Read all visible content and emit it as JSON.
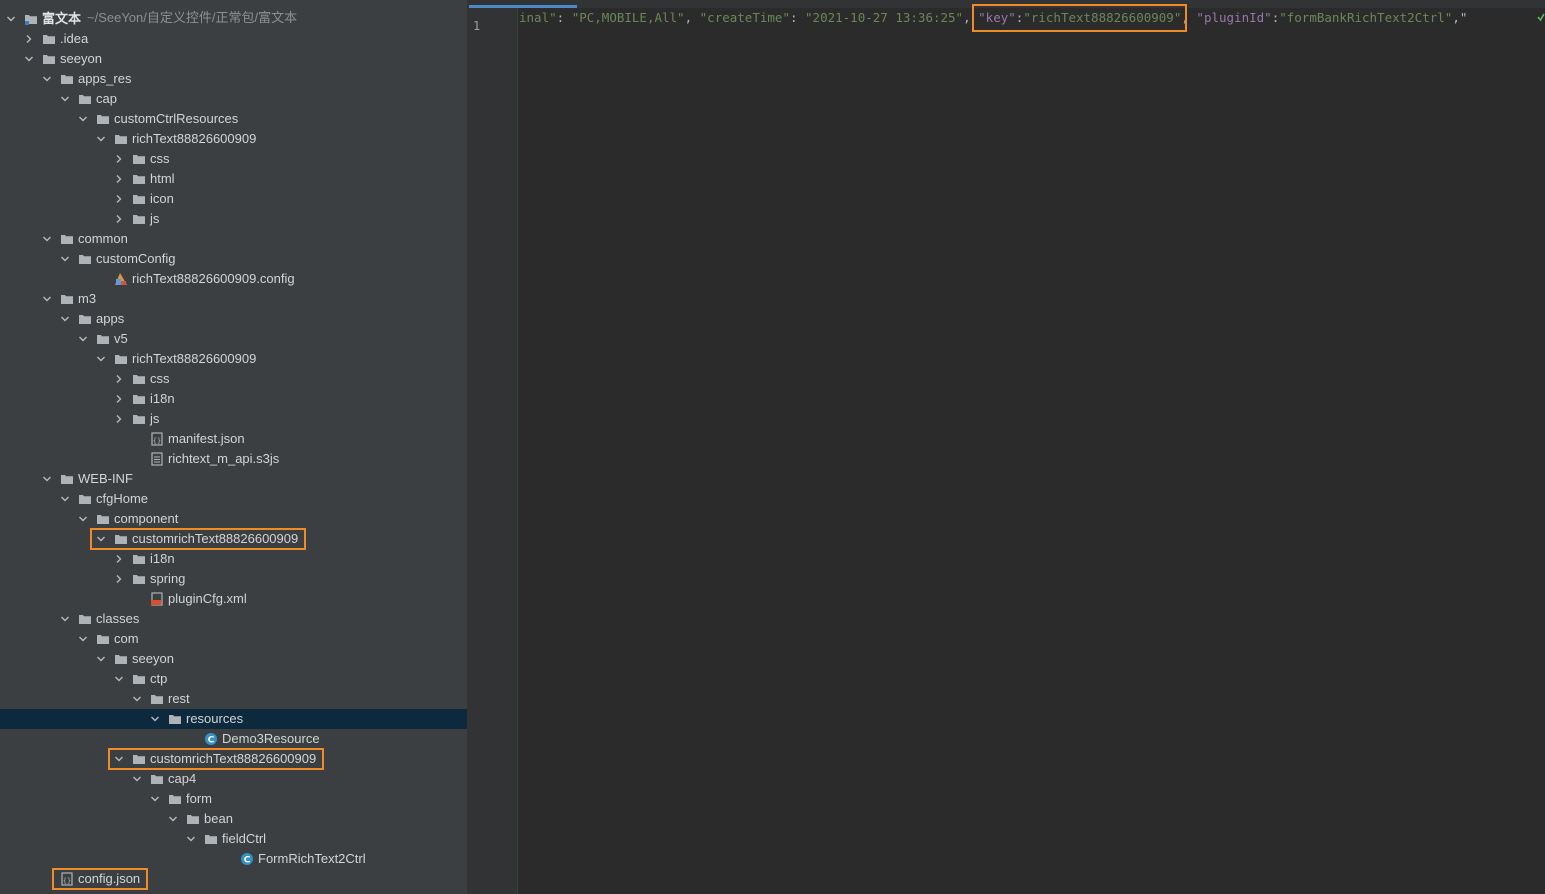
{
  "project": {
    "name": "富文本",
    "path": "~/SeeYon/自定义控件/正常包/富文本"
  },
  "tree": [
    {
      "label": "富文本",
      "level": 0,
      "icon": "project-icon",
      "expanded": true,
      "bold": true
    },
    {
      "label": ".idea",
      "level": 1,
      "icon": "folder-icon",
      "expanded": false
    },
    {
      "label": "seeyon",
      "level": 1,
      "icon": "folder-icon",
      "expanded": true
    },
    {
      "label": "apps_res",
      "level": 2,
      "icon": "folder-icon",
      "expanded": true
    },
    {
      "label": "cap",
      "level": 3,
      "icon": "folder-icon",
      "expanded": true
    },
    {
      "label": "customCtrlResources",
      "level": 4,
      "icon": "folder-icon",
      "expanded": true
    },
    {
      "label": "richText88826600909",
      "level": 5,
      "icon": "folder-icon",
      "expanded": true
    },
    {
      "label": "css",
      "level": 6,
      "icon": "folder-icon",
      "expanded": false
    },
    {
      "label": "html",
      "level": 6,
      "icon": "folder-icon",
      "expanded": false
    },
    {
      "label": "icon",
      "level": 6,
      "icon": "folder-icon",
      "expanded": false
    },
    {
      "label": "js",
      "level": 6,
      "icon": "folder-icon",
      "expanded": false
    },
    {
      "label": "common",
      "level": 2,
      "icon": "folder-icon",
      "expanded": true
    },
    {
      "label": "customConfig",
      "level": 3,
      "icon": "folder-icon",
      "expanded": true
    },
    {
      "label": "richText88826600909.config",
      "level": 5,
      "icon": "config-file-icon"
    },
    {
      "label": "m3",
      "level": 2,
      "icon": "folder-icon",
      "expanded": true
    },
    {
      "label": "apps",
      "level": 3,
      "icon": "folder-icon",
      "expanded": true
    },
    {
      "label": "v5",
      "level": 4,
      "icon": "folder-icon",
      "expanded": true
    },
    {
      "label": "richText88826600909",
      "level": 5,
      "icon": "folder-icon",
      "expanded": true
    },
    {
      "label": "css",
      "level": 6,
      "icon": "folder-icon",
      "expanded": false
    },
    {
      "label": "i18n",
      "level": 6,
      "icon": "folder-icon",
      "expanded": false
    },
    {
      "label": "js",
      "level": 6,
      "icon": "folder-icon",
      "expanded": false
    },
    {
      "label": "manifest.json",
      "level": 7,
      "icon": "json-file-icon"
    },
    {
      "label": "richtext_m_api.s3js",
      "level": 7,
      "icon": "text-file-icon"
    },
    {
      "label": "WEB-INF",
      "level": 2,
      "icon": "folder-icon",
      "expanded": true
    },
    {
      "label": "cfgHome",
      "level": 3,
      "icon": "folder-icon",
      "expanded": true
    },
    {
      "label": "component",
      "level": 4,
      "icon": "folder-icon",
      "expanded": true
    },
    {
      "label": "customrichText88826600909",
      "level": 5,
      "icon": "folder-icon",
      "expanded": true,
      "highlight": true
    },
    {
      "label": "i18n",
      "level": 6,
      "icon": "folder-icon",
      "expanded": false
    },
    {
      "label": "spring",
      "level": 6,
      "icon": "folder-icon",
      "expanded": false
    },
    {
      "label": "pluginCfg.xml",
      "level": 7,
      "icon": "xml-file-icon"
    },
    {
      "label": "classes",
      "level": 3,
      "icon": "folder-icon",
      "expanded": true
    },
    {
      "label": "com",
      "level": 4,
      "icon": "folder-icon",
      "expanded": true
    },
    {
      "label": "seeyon",
      "level": 5,
      "icon": "folder-icon",
      "expanded": true
    },
    {
      "label": "ctp",
      "level": 6,
      "icon": "folder-icon",
      "expanded": true
    },
    {
      "label": "rest",
      "level": 7,
      "icon": "folder-icon",
      "expanded": true
    },
    {
      "label": "resources",
      "level": 8,
      "icon": "folder-icon",
      "expanded": true,
      "selected": true
    },
    {
      "label": "Demo3Resource",
      "level": 10,
      "icon": "java-class-icon"
    },
    {
      "label": "customrichText88826600909",
      "level": 6,
      "icon": "folder-icon",
      "expanded": true,
      "highlight": true
    },
    {
      "label": "cap4",
      "level": 7,
      "icon": "folder-icon",
      "expanded": true
    },
    {
      "label": "form",
      "level": 8,
      "icon": "folder-icon",
      "expanded": true
    },
    {
      "label": "bean",
      "level": 9,
      "icon": "folder-icon",
      "expanded": true
    },
    {
      "label": "fieldCtrl",
      "level": 10,
      "icon": "folder-icon",
      "expanded": true
    },
    {
      "label": "FormRichText2Ctrl",
      "level": 12,
      "icon": "java-class-icon"
    },
    {
      "label": "config.json",
      "level": 2,
      "icon": "json-file-icon",
      "highlight": true
    }
  ],
  "editor": {
    "line_number": "1",
    "tokens": [
      {
        "t": "inal\"",
        "c": "s"
      },
      {
        "t": ": ",
        "c": "p"
      },
      {
        "t": "\"PC,MOBILE,All\"",
        "c": "s"
      },
      {
        "t": ", ",
        "c": "p"
      },
      {
        "t": "\"createTime\"",
        "c": "s"
      },
      {
        "t": ": ",
        "c": "p"
      },
      {
        "t": "\"2021-10-27 13:36:25\"",
        "c": "s"
      },
      {
        "t": ", ",
        "c": "p"
      },
      {
        "t": "\"key\"",
        "c": "k"
      },
      {
        "t": ":",
        "c": "p"
      },
      {
        "t": "\"richText88826600909\"",
        "c": "s"
      },
      {
        "t": ", ",
        "c": "p"
      },
      {
        "t": "\"pluginId\"",
        "c": "k"
      },
      {
        "t": ":",
        "c": "p"
      },
      {
        "t": "\"formBankRichText2Ctrl\"",
        "c": "s"
      },
      {
        "t": ",\"",
        "c": "p"
      }
    ]
  }
}
